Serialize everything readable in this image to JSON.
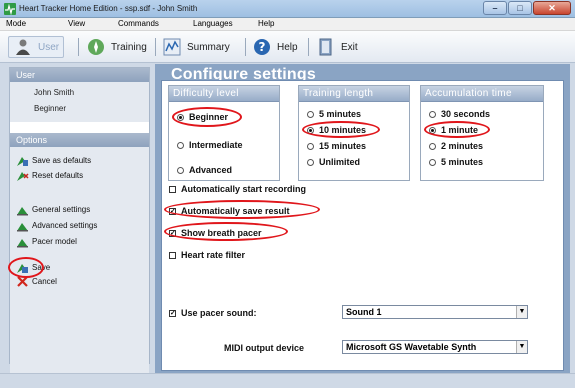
{
  "window": {
    "title": "Heart Tracker Home Edition - ssp.sdf - John Smith",
    "icon": "heart-monitor-icon"
  },
  "menu": {
    "mode": "Mode",
    "view": "View",
    "commands": "Commands",
    "languages": "Languages",
    "help": "Help"
  },
  "toolbar": {
    "user": "User",
    "training": "Training",
    "summary": "Summary",
    "help": "Help",
    "exit": "Exit"
  },
  "sidebar": {
    "user_header": "User",
    "user_name": "John Smith",
    "user_level": "Beginner",
    "options_header": "Options",
    "save_as_defaults": "Save as defaults",
    "reset_defaults": "Reset defaults",
    "general_settings": "General settings",
    "advanced_settings": "Advanced settings",
    "pacer_model": "Pacer model",
    "save": "Save",
    "cancel": "Cancel"
  },
  "main": {
    "title": "Configure settings",
    "difficulty": {
      "header": "Difficulty level",
      "options": [
        "Beginner",
        "Intermediate",
        "Advanced"
      ],
      "selected": "Beginner"
    },
    "training_length": {
      "header": "Training length",
      "options": [
        "5 minutes",
        "10 minutes",
        "15 minutes",
        "Unlimited"
      ],
      "selected": "10 minutes"
    },
    "accumulation": {
      "header": "Accumulation time",
      "options": [
        "30 seconds",
        "1 minute",
        "2 minutes",
        "5 minutes"
      ],
      "selected": "1 minute"
    },
    "checkboxes": {
      "auto_start": {
        "label": "Automatically start recording",
        "checked": false
      },
      "auto_save": {
        "label": "Automatically save result",
        "checked": true
      },
      "breath_pacer": {
        "label": "Show breath pacer",
        "checked": true
      },
      "hr_filter": {
        "label": "Heart rate filter",
        "checked": false
      }
    },
    "pacer_sound": {
      "label": "Use pacer sound:",
      "checked": true,
      "value": "Sound 1"
    },
    "midi": {
      "label": "MIDI output device",
      "value": "Microsoft GS Wavetable Synth"
    }
  },
  "colors": {
    "highlight": "#e0161b",
    "panel": "#8aa4c4",
    "header_gradient_top": "#c7d3e3"
  }
}
